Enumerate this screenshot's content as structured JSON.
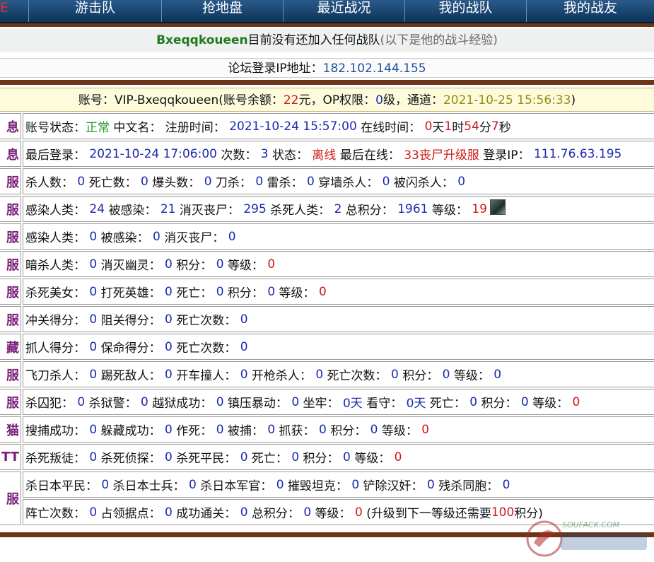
{
  "nav": {
    "items": [
      "E",
      "游击队",
      "抢地盘",
      "最近战况",
      "我的战队",
      "我的战友"
    ]
  },
  "title": {
    "username": "Bxeqqkoueen",
    "message": "目前没有还加入任何战队",
    "note": "(以下是他的战斗经验)"
  },
  "forum_ip": {
    "label": "论坛登录IP地址：",
    "value": "182.102.144.155"
  },
  "account": {
    "label": "账号：VIP-Bxeqqkoueen(账号余额：",
    "balance": "22",
    "balance_unit": "元，OP权限：",
    "op": "0",
    "op_unit": "级，通道：",
    "channel_time": "2021-10-25 15:56:33",
    "close": ")"
  },
  "rows": [
    {
      "label": "息",
      "parts": [
        {
          "t": "账号状态："
        },
        {
          "t": "正常",
          "c": "green"
        },
        {
          "t": " 中文名： 注册时间： "
        },
        {
          "t": "2021-10-24 15:57:00",
          "c": "num"
        },
        {
          "t": " 在线时间： "
        },
        {
          "t": "0",
          "c": "red"
        },
        {
          "t": "天"
        },
        {
          "t": "1",
          "c": "red"
        },
        {
          "t": "时"
        },
        {
          "t": "54",
          "c": "red"
        },
        {
          "t": "分"
        },
        {
          "t": "7",
          "c": "red"
        },
        {
          "t": "秒"
        }
      ]
    },
    {
      "label": "息",
      "parts": [
        {
          "t": "最后登录： "
        },
        {
          "t": "2021-10-24 17:06:00",
          "c": "num"
        },
        {
          "t": " 次数： "
        },
        {
          "t": "3",
          "c": "num"
        },
        {
          "t": " 状态： "
        },
        {
          "t": "离线",
          "c": "red"
        },
        {
          "t": " 最后在线： "
        },
        {
          "t": "33丧尸升级服",
          "c": "red"
        },
        {
          "t": " 登录IP： "
        },
        {
          "t": "111.76.63.195",
          "c": "num"
        }
      ]
    },
    {
      "label": "服",
      "parts": [
        {
          "t": "杀人数： "
        },
        {
          "t": "0",
          "c": "num"
        },
        {
          "t": " 死亡数： "
        },
        {
          "t": "0",
          "c": "num"
        },
        {
          "t": " 爆头数： "
        },
        {
          "t": "0",
          "c": "num"
        },
        {
          "t": " 刀杀： "
        },
        {
          "t": "0",
          "c": "num"
        },
        {
          "t": " 雷杀： "
        },
        {
          "t": "0",
          "c": "num"
        },
        {
          "t": " 穿墙杀人： "
        },
        {
          "t": "0",
          "c": "num"
        },
        {
          "t": " 被闪杀人： "
        },
        {
          "t": "0",
          "c": "num"
        }
      ]
    },
    {
      "label": "服",
      "avatar": true,
      "parts": [
        {
          "t": "感染人类： "
        },
        {
          "t": "24",
          "c": "num"
        },
        {
          "t": " 被感染： "
        },
        {
          "t": "21",
          "c": "num"
        },
        {
          "t": " 消灭丧尸： "
        },
        {
          "t": "295",
          "c": "num"
        },
        {
          "t": " 杀死人类： "
        },
        {
          "t": "2",
          "c": "num"
        },
        {
          "t": " 总积分： "
        },
        {
          "t": "1961",
          "c": "num"
        },
        {
          "t": " 等级： "
        },
        {
          "t": "19",
          "c": "red"
        }
      ]
    },
    {
      "label": "服",
      "parts": [
        {
          "t": "感染人类： "
        },
        {
          "t": "0",
          "c": "num"
        },
        {
          "t": " 被感染： "
        },
        {
          "t": "0",
          "c": "num"
        },
        {
          "t": " 消灭丧尸： "
        },
        {
          "t": "0",
          "c": "num"
        }
      ]
    },
    {
      "label": "服",
      "parts": [
        {
          "t": "暗杀人类： "
        },
        {
          "t": "0",
          "c": "num"
        },
        {
          "t": " 消灭幽灵： "
        },
        {
          "t": "0",
          "c": "num"
        },
        {
          "t": " 积分： "
        },
        {
          "t": "0",
          "c": "num"
        },
        {
          "t": " 等级： "
        },
        {
          "t": "0",
          "c": "red"
        }
      ]
    },
    {
      "label": "服",
      "parts": [
        {
          "t": "杀死美女： "
        },
        {
          "t": "0",
          "c": "num"
        },
        {
          "t": " 打死英雄： "
        },
        {
          "t": "0",
          "c": "num"
        },
        {
          "t": " 死亡： "
        },
        {
          "t": "0",
          "c": "num"
        },
        {
          "t": " 积分： "
        },
        {
          "t": "0",
          "c": "num"
        },
        {
          "t": " 等级： "
        },
        {
          "t": "0",
          "c": "red"
        }
      ]
    },
    {
      "label": "服",
      "parts": [
        {
          "t": "冲关得分： "
        },
        {
          "t": "0",
          "c": "num"
        },
        {
          "t": " 阻关得分： "
        },
        {
          "t": "0",
          "c": "num"
        },
        {
          "t": " 死亡次数： "
        },
        {
          "t": "0",
          "c": "num"
        }
      ]
    },
    {
      "label": "藏",
      "parts": [
        {
          "t": "抓人得分： "
        },
        {
          "t": "0",
          "c": "num"
        },
        {
          "t": " 保命得分： "
        },
        {
          "t": "0",
          "c": "num"
        },
        {
          "t": " 死亡次数： "
        },
        {
          "t": "0",
          "c": "num"
        }
      ]
    },
    {
      "label": "服",
      "parts": [
        {
          "t": "飞刀杀人： "
        },
        {
          "t": "0",
          "c": "num"
        },
        {
          "t": " 踢死敌人： "
        },
        {
          "t": "0",
          "c": "num"
        },
        {
          "t": " 开车撞人： "
        },
        {
          "t": "0",
          "c": "num"
        },
        {
          "t": " 开枪杀人： "
        },
        {
          "t": "0",
          "c": "num"
        },
        {
          "t": " 死亡次数： "
        },
        {
          "t": "0",
          "c": "num"
        },
        {
          "t": " 积分： "
        },
        {
          "t": "0",
          "c": "num"
        },
        {
          "t": " 等级： "
        },
        {
          "t": "0",
          "c": "num"
        }
      ]
    },
    {
      "label": "服",
      "parts": [
        {
          "t": "杀囚犯： "
        },
        {
          "t": "0",
          "c": "num"
        },
        {
          "t": " 杀狱警： "
        },
        {
          "t": "0",
          "c": "num"
        },
        {
          "t": " 越狱成功： "
        },
        {
          "t": "0",
          "c": "num"
        },
        {
          "t": " 镇压暴动： "
        },
        {
          "t": "0",
          "c": "num"
        },
        {
          "t": " 坐牢： "
        },
        {
          "t": "0天",
          "c": "num"
        },
        {
          "t": " 看守： "
        },
        {
          "t": "0天",
          "c": "num"
        },
        {
          "t": " 死亡： "
        },
        {
          "t": "0",
          "c": "num"
        },
        {
          "t": " 积分： "
        },
        {
          "t": "0",
          "c": "num"
        },
        {
          "t": " 等级： "
        },
        {
          "t": "0",
          "c": "red"
        }
      ]
    },
    {
      "label": "猫",
      "parts": [
        {
          "t": "搜捕成功： "
        },
        {
          "t": "0",
          "c": "num"
        },
        {
          "t": " 躲藏成功： "
        },
        {
          "t": "0",
          "c": "num"
        },
        {
          "t": " 作死： "
        },
        {
          "t": "0",
          "c": "num"
        },
        {
          "t": " 被捕： "
        },
        {
          "t": "0",
          "c": "num"
        },
        {
          "t": " 抓获： "
        },
        {
          "t": "0",
          "c": "num"
        },
        {
          "t": " 积分： "
        },
        {
          "t": "0",
          "c": "num"
        },
        {
          "t": " 等级： "
        },
        {
          "t": "0",
          "c": "red"
        }
      ]
    },
    {
      "label": "TT",
      "parts": [
        {
          "t": "杀死叛徒： "
        },
        {
          "t": "0",
          "c": "num"
        },
        {
          "t": " 杀死侦探： "
        },
        {
          "t": "0",
          "c": "num"
        },
        {
          "t": " 杀死平民： "
        },
        {
          "t": "0",
          "c": "num"
        },
        {
          "t": " 死亡： "
        },
        {
          "t": "0",
          "c": "num"
        },
        {
          "t": " 积分： "
        },
        {
          "t": "0",
          "c": "num"
        },
        {
          "t": " 等级： "
        },
        {
          "t": "0",
          "c": "red"
        }
      ]
    }
  ],
  "last_block": {
    "label": "服",
    "line1": [
      {
        "t": "杀日本平民： "
      },
      {
        "t": "0",
        "c": "num"
      },
      {
        "t": " 杀日本士兵： "
      },
      {
        "t": "0",
        "c": "num"
      },
      {
        "t": " 杀日本军官： "
      },
      {
        "t": "0",
        "c": "num"
      },
      {
        "t": " 摧毁坦克： "
      },
      {
        "t": "0",
        "c": "num"
      },
      {
        "t": " 铲除汉奸： "
      },
      {
        "t": "0",
        "c": "num"
      },
      {
        "t": " 残杀同胞： "
      },
      {
        "t": "0",
        "c": "num"
      }
    ],
    "line2": [
      {
        "t": "阵亡次数： "
      },
      {
        "t": "0",
        "c": "num"
      },
      {
        "t": " 占领据点： "
      },
      {
        "t": "0",
        "c": "num"
      },
      {
        "t": " 成功通关： "
      },
      {
        "t": "0",
        "c": "num"
      },
      {
        "t": " 总积分： "
      },
      {
        "t": "0",
        "c": "num"
      },
      {
        "t": " 等级： "
      },
      {
        "t": "0",
        "c": "red"
      },
      {
        "t": " (升级到下一等级还需要"
      },
      {
        "t": "100",
        "c": "red"
      },
      {
        "t": "积分)"
      }
    ]
  },
  "watermark": {
    "text": "SOUFACK.COM"
  }
}
